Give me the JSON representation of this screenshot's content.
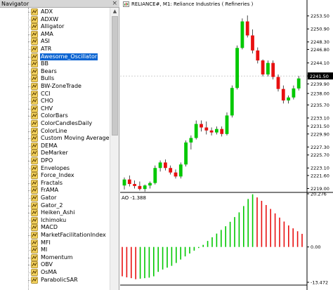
{
  "navigator": {
    "title": "Navigator",
    "close_glyph": "×",
    "scroll_up_glyph": "▲",
    "items": [
      "ADX",
      "ADXW",
      "Alligator",
      "AMA",
      "ASI",
      "ATR",
      "Awesome_Oscillator",
      "BB",
      "Bears",
      "Bulls",
      "BW-ZoneTrade",
      "CCI",
      "CHO",
      "CHV",
      "ColorBars",
      "ColorCandlesDaily",
      "ColorLine",
      "Custom Moving Average",
      "DEMA",
      "DeMarker",
      "DPO",
      "Envelopes",
      "Force_Index",
      "Fractals",
      "FrAMA",
      "Gator",
      "Gator_2",
      "Heiken_Ashi",
      "Ichimoku",
      "MACD",
      "MarketFacilitationIndex",
      "MFI",
      "MI",
      "Momentum",
      "OBV",
      "OsMA",
      "ParabolicSAR"
    ],
    "selected_index": 6
  },
  "chart": {
    "title": "RELIANCE#, M1:  Reliance Industries ( Refineries )",
    "current_price": "2241.50",
    "price_axis": [
      "2253.50",
      "2250.90",
      "2248.30",
      "2246.80",
      "2244.10",
      "2241.50",
      "2239.90",
      "2238.00",
      "2235.70",
      "2233.10",
      "2231.50",
      "2229.90",
      "2227.30",
      "2225.70",
      "2223.10",
      "2221.60",
      "2219.00"
    ],
    "ao_label": "AO -1.388",
    "ao_axis": [
      "20.276",
      "0.00",
      "-13.472"
    ],
    "colors": {
      "bull": "#00c800",
      "bear": "#e81010",
      "grid": "#dcdcdc",
      "price_label_bg": "#000000"
    }
  },
  "chart_data": [
    {
      "type": "candlestick",
      "title": "RELIANCE#, M1:  Reliance Industries ( Refineries )",
      "ylim": [
        2218.5,
        2255.0
      ],
      "series": [
        {
          "name": "RELIANCE#",
          "ohlc": [
            [
              2219.6,
              2221.2,
              2218.8,
              2220.8
            ],
            [
              2220.8,
              2221.6,
              2219.4,
              2219.9
            ],
            [
              2219.9,
              2220.6,
              2219.0,
              2219.5
            ],
            [
              2219.5,
              2220.4,
              2218.6,
              2218.9
            ],
            [
              2218.9,
              2219.8,
              2218.4,
              2219.6
            ],
            [
              2219.6,
              2220.4,
              2219.0,
              2220.1
            ],
            [
              2220.1,
              2223.6,
              2219.8,
              2223.1
            ],
            [
              2223.1,
              2224.6,
              2222.4,
              2224.2
            ],
            [
              2224.2,
              2224.8,
              2222.6,
              2223.1
            ],
            [
              2223.1,
              2223.6,
              2221.8,
              2222.2
            ],
            [
              2222.2,
              2222.8,
              2221.0,
              2221.4
            ],
            [
              2221.4,
              2224.2,
              2221.0,
              2223.8
            ],
            [
              2223.8,
              2228.6,
              2223.4,
              2228.2
            ],
            [
              2228.2,
              2229.6,
              2226.8,
              2229.1
            ],
            [
              2229.1,
              2232.6,
              2228.8,
              2231.9
            ],
            [
              2231.9,
              2232.6,
              2230.4,
              2231.2
            ],
            [
              2231.2,
              2232.4,
              2229.8,
              2230.6
            ],
            [
              2230.6,
              2231.2,
              2229.6,
              2230.2
            ],
            [
              2230.2,
              2231.4,
              2229.8,
              2230.9
            ],
            [
              2230.9,
              2231.4,
              2229.4,
              2229.9
            ],
            [
              2229.9,
              2234.2,
              2229.6,
              2233.6
            ],
            [
              2233.6,
              2239.6,
              2233.2,
              2239.1
            ],
            [
              2239.1,
              2247.6,
              2238.8,
              2247.1
            ],
            [
              2247.1,
              2253.0,
              2246.8,
              2252.4
            ],
            [
              2252.4,
              2253.6,
              2249.2,
              2249.6
            ],
            [
              2249.6,
              2250.8,
              2246.0,
              2246.6
            ],
            [
              2246.6,
              2247.2,
              2244.0,
              2244.6
            ],
            [
              2244.6,
              2244.8,
              2241.4,
              2241.8
            ],
            [
              2241.8,
              2244.6,
              2241.4,
              2244.1
            ],
            [
              2244.1,
              2244.6,
              2240.8,
              2241.3
            ],
            [
              2241.3,
              2241.8,
              2238.4,
              2238.9
            ],
            [
              2238.9,
              2239.6,
              2236.0,
              2236.6
            ],
            [
              2236.6,
              2237.6,
              2236.0,
              2237.2
            ],
            [
              2237.2,
              2239.6,
              2236.8,
              2239.0
            ],
            [
              2239.0,
              2241.5,
              2238.6,
              2241.0
            ]
          ]
        }
      ]
    },
    {
      "type": "bar",
      "title": "AO -1.388",
      "ylim": [
        -13.472,
        20.276
      ],
      "series": [
        {
          "name": "AO",
          "values": [
            -11.2,
            -11.6,
            -11.9,
            -12.3,
            -12.1,
            -11.9,
            -11.7,
            -11.2,
            -9.5,
            -8.6,
            -7.9,
            -7.2,
            -6.1,
            -4.8,
            -3.6,
            -2.5,
            -1.4,
            -0.4,
            0.8,
            2.3,
            3.7,
            5.1,
            6.5,
            7.9,
            9.6,
            11.4,
            13.2,
            15.6,
            18.3,
            20.1,
            18.9,
            17.6,
            16.0,
            14.5,
            12.8,
            11.2,
            9.7,
            8.2,
            7.1,
            6.0,
            5.0
          ]
        }
      ]
    }
  ]
}
